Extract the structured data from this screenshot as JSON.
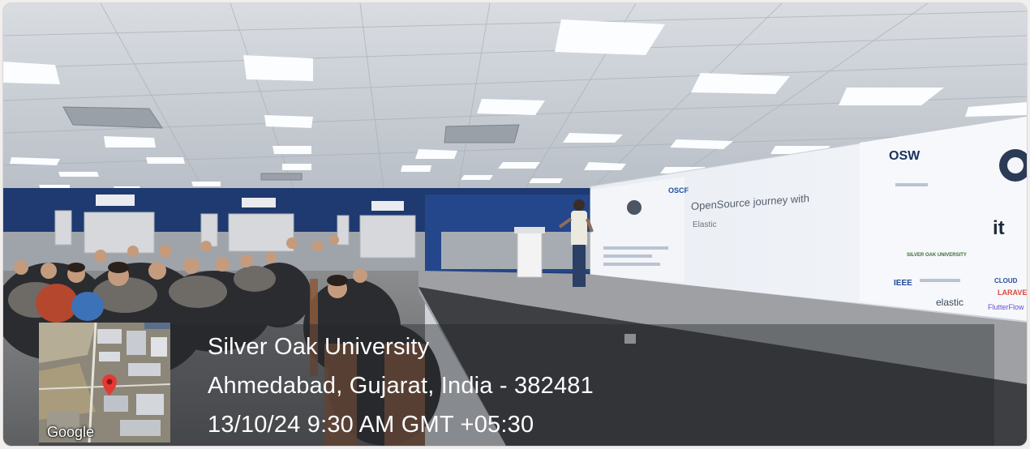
{
  "location": {
    "name": "Silver Oak University",
    "address": "Ahmedabad, Gujarat, India - 382481",
    "datetime": "13/10/24 9:30 AM GMT +05:30"
  },
  "map": {
    "attribution": "Google",
    "icon": "map-pin-icon"
  },
  "screen": {
    "title": "OpenSource journey with",
    "subtitle": "Elastic",
    "brands": {
      "osw": "OSW",
      "oscf": "OSCF",
      "it": "it",
      "ieee": "IEEE",
      "elastic": "elastic",
      "silver_oak": "SILVER OAK UNIVERSITY",
      "cloud": "CLOUD",
      "laravel": "LARAVEL",
      "flutterflow": "FlutterFlow"
    }
  },
  "colors": {
    "pin": "#e53935",
    "overlay": "rgba(35,38,42,0.42)",
    "wall": "#1f3a70"
  }
}
